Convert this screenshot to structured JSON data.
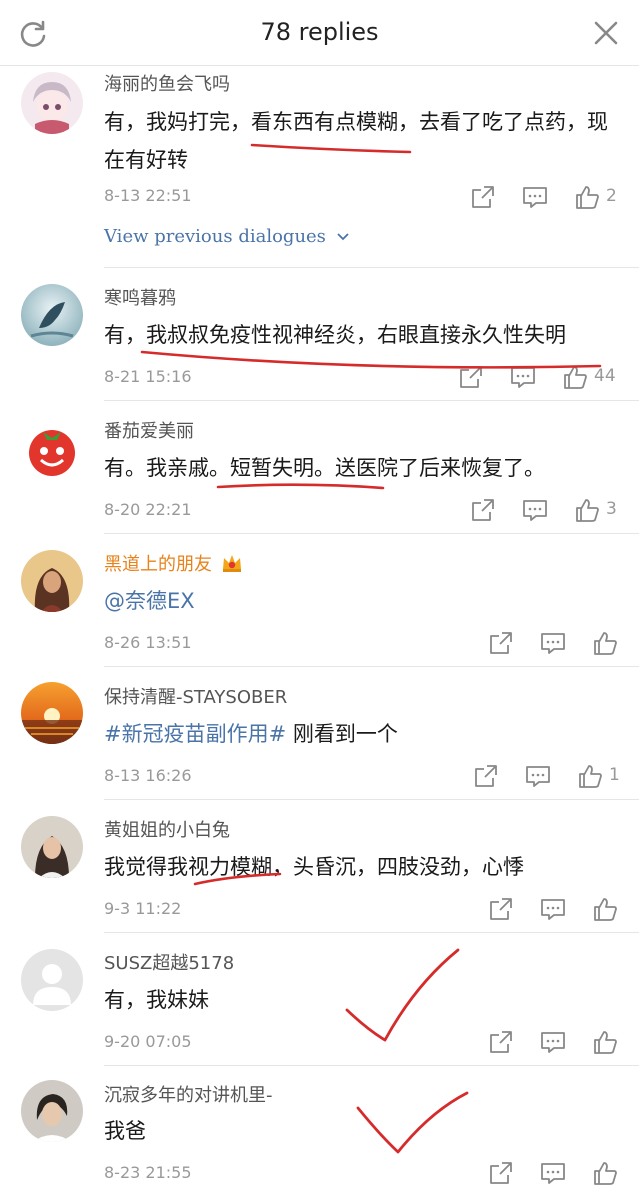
{
  "header": {
    "title": "78 replies",
    "left_icon": "refresh-icon",
    "right_icon": "close-icon"
  },
  "comments": [
    {
      "username": "海丽的鱼会飞吗",
      "text": "有，我妈打完，看东西有点模糊，去看了吃了点药，现在有好转",
      "time": "8-13 22:51",
      "likes": "2",
      "view_previous": "View previous dialogues"
    },
    {
      "username": "寒鸣暮鸦",
      "text": "有，我叔叔免疫性视神经炎，右眼直接永久性失明",
      "time": "8-21 15:16",
      "likes": "44"
    },
    {
      "username": "番茄爱美丽",
      "text": "有。我亲戚。短暂失明。送医院了后来恢复了。",
      "time": "8-20 22:21",
      "likes": "3"
    },
    {
      "username": "黑道上的朋友",
      "badge": "crown-badge-icon",
      "text": "@奈德EX",
      "time": "8-26 13:51",
      "likes": ""
    },
    {
      "username": "保持清醒-STAYSOBER",
      "hashtag": "#新冠疫苗副作用#",
      "text_after": " 刚看到一个",
      "time": "8-13 16:26",
      "likes": "1"
    },
    {
      "username": "黄姐姐的小白兔",
      "text": "我觉得我视力模糊，头昏沉，四肢没劲，心悸",
      "time": "9-3 11:22",
      "likes": ""
    },
    {
      "username": "SUSZ超越5178",
      "text": "有，我妹妹",
      "time": "9-20 07:05",
      "likes": ""
    },
    {
      "username": "沉寂多年的对讲机里-",
      "text": "我爸",
      "time": "8-23 21:55",
      "likes": ""
    }
  ],
  "colors": {
    "link": "#4a74a8",
    "orange_username": "#e8831c",
    "annotation": "#d62b2b"
  }
}
